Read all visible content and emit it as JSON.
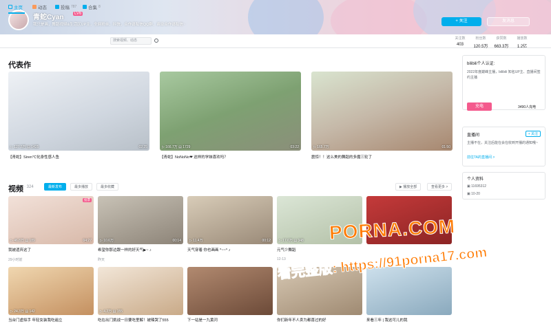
{
  "header": {
    "username": "青蛇Cyan",
    "level_badge": "LV6",
    "signature": "我只是画，舞蹈视频&生活区UP主，全网粉丝，抖快，合作请私信QQ群，商业合作请私信~",
    "follow_label": "+ 关注",
    "message_label": "发消息"
  },
  "nav": {
    "tabs": [
      {
        "label": "主页",
        "count": ""
      },
      {
        "label": "动态",
        "count": ""
      },
      {
        "label": "投稿",
        "count": "787"
      },
      {
        "label": "合集",
        "count": "8"
      }
    ],
    "search_placeholder": "搜索视频、动态"
  },
  "stats": [
    {
      "key": "关注数",
      "value": "403"
    },
    {
      "key": "粉丝数",
      "value": "120.5万"
    },
    {
      "key": "获赞数",
      "value": "663.3万"
    },
    {
      "key": "播放数",
      "value": "1.2亿"
    }
  ],
  "masterpiece": {
    "title": "代表作",
    "cards": [
      {
        "views": "127.5万",
        "danmaku": "1425",
        "duration": "02:25",
        "title": "【青蛇】Siren℃化身性感人鱼"
      },
      {
        "views": "166.7万",
        "danmaku": "1729",
        "duration": "03:22",
        "title": "【青蛇】NoNoNo❤ 这样的学妹喜欢吗？"
      },
      {
        "views": "165.7万",
        "danmaku": "",
        "duration": "01:50",
        "title": "震惊！！这么美的舞蹈的多魔三轮了"
      }
    ]
  },
  "videos": {
    "title": "视频",
    "count": "· 324",
    "filters": [
      "最新发布",
      "最多播放",
      "最多收藏"
    ],
    "play_all": "▶ 播放全部",
    "more": "查看更多 >",
    "row1": [
      {
        "views": "46.8万",
        "danmaku": "189",
        "duration": "04:27",
        "title": "我被遗弃这了",
        "date": "29小时前",
        "badge": "投票"
      },
      {
        "views": "10.6万",
        "danmaku": "",
        "duration": "00:14",
        "title": "希望你那边跟一样的好天气▶~ ♪",
        "date": "昨天",
        "badge": ""
      },
      {
        "views": "11.4万",
        "danmaku": "",
        "duration": "00:12",
        "title": "天气穿着 你也画画 *~~^ ♪",
        "date": "",
        "badge": ""
      },
      {
        "views": "17.6万",
        "danmaku": "348",
        "duration": "",
        "title": "元气少舞蹈",
        "date": "12-13",
        "badge": ""
      },
      {
        "views": "",
        "danmaku": "",
        "duration": "",
        "title": "",
        "date": "",
        "badge": ""
      }
    ],
    "row2": [
      {
        "views": "24.3万",
        "danmaku": "142",
        "duration": "",
        "title": "当台门虚拟手 年轻女装我吃遍立",
        "date": "",
        "badge": ""
      },
      {
        "views": "4.2万",
        "danmaku": "155",
        "duration": "",
        "title": "吃在出门挑战一日要吃里解！被辣哭了555",
        "date": "",
        "badge": ""
      },
      {
        "views": "",
        "danmaku": "",
        "duration": "",
        "title": "下一站是一九黄河",
        "date": "",
        "badge": ""
      },
      {
        "views": "",
        "danmaku": "",
        "duration": "",
        "title": "你们新年不人卖为都喜过的好",
        "date": "",
        "badge": ""
      },
      {
        "views": "",
        "danmaku": "",
        "duration": "",
        "title": "来看三年 | 我这可儿的我",
        "date": "",
        "badge": ""
      }
    ]
  },
  "sidebar": {
    "auth_label": "bilibili个人认证:",
    "auth_text": "2022年度巅峰主播，bilibili 知名UP主、直播间签约主播",
    "charge_label": "充电",
    "charge_count": "3490人充电",
    "live_title": "直播间",
    "live_follow": "+ 关注",
    "live_desc": "主播不在，关注后能在会在收到开播的通知哦~",
    "live_link": "前往TA的直播间 >",
    "info_title": "个人资料",
    "uid": "11695312",
    "birthday": "10-20"
  },
  "watermark": {
    "line1": "PORNA.COM",
    "line2": "看完整版: https://91porna17.com"
  },
  "colors": {
    "accent": "#00aeec",
    "pink": "#f45a8d",
    "watermark": "#ff7a00"
  }
}
